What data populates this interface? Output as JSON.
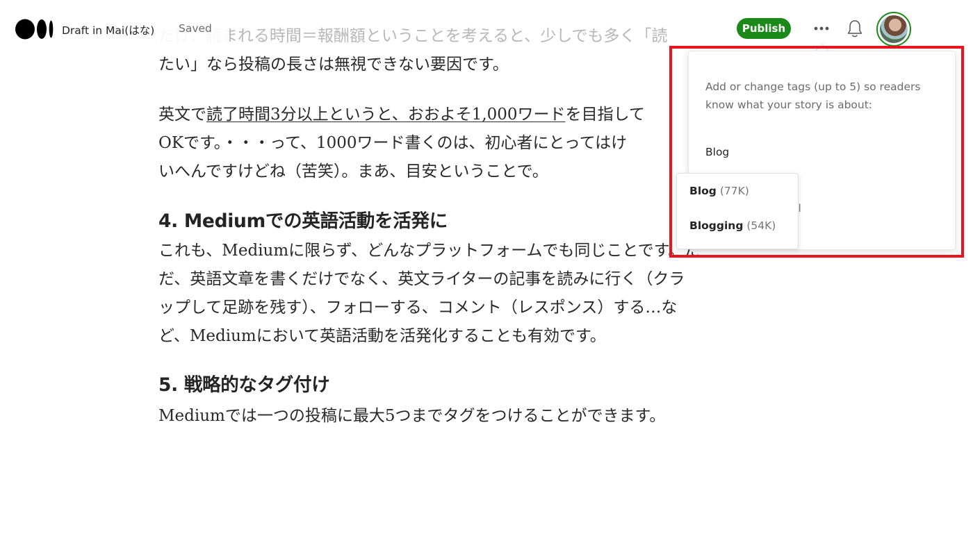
{
  "header": {
    "draft_label": "Draft in Mai(はな)",
    "saved_label": "Saved",
    "publish_label": "Publish",
    "more_icon": "more-horizontal-icon",
    "bell_icon": "bell-icon",
    "avatar_icon": "user-avatar"
  },
  "article": {
    "para1": {
      "line1": "だけ、読まれる時間＝報酬額ということを考えると、少しでも多く「読",
      "line2": "たい」なら投稿の長さは無視できない要因です。"
    },
    "para2": {
      "line1_pre": "英文で",
      "line1_link": "読了時間3分以上というと、おおよそ1,000ワード",
      "line1_post": "を目指して",
      "line2": "OKです。・・・って、1000ワード書くのは、初心者にとってはけ",
      "line3": "いへんですけどね（苦笑）。まあ、目安ということで。"
    },
    "heading4": "4.   Mediumでの英語活動を活発に",
    "para3": {
      "line1": "これも、Mediumに限らず、どんなプラットフォームでも同じことです。た",
      "line2": "だ、英語文章を書くだけでなく、英文ライターの記事を読みに行く（クラ",
      "line3": "ップして足跡を残す）、フォローする、コメント（レスポンス）する…な",
      "line4": "ど、Mediumにおいて英語活動を活発化することも有効です。"
    },
    "heading5": "5.   戦略的なタグ付け",
    "para4": "Mediumでは一つの投稿に最大5つまでタグをつけることができます。"
  },
  "tag_popover": {
    "help_text": "Add or change tags (up to 5) so readers know what your story is about:",
    "input_value": "Blog",
    "partial_text": "el",
    "suggestions": [
      {
        "name": "Blog",
        "count": "(77K)"
      },
      {
        "name": "Blogging",
        "count": "(54K)"
      }
    ]
  },
  "colors": {
    "publish_green": "#1a8917",
    "annotation_red": "#e8141f"
  }
}
